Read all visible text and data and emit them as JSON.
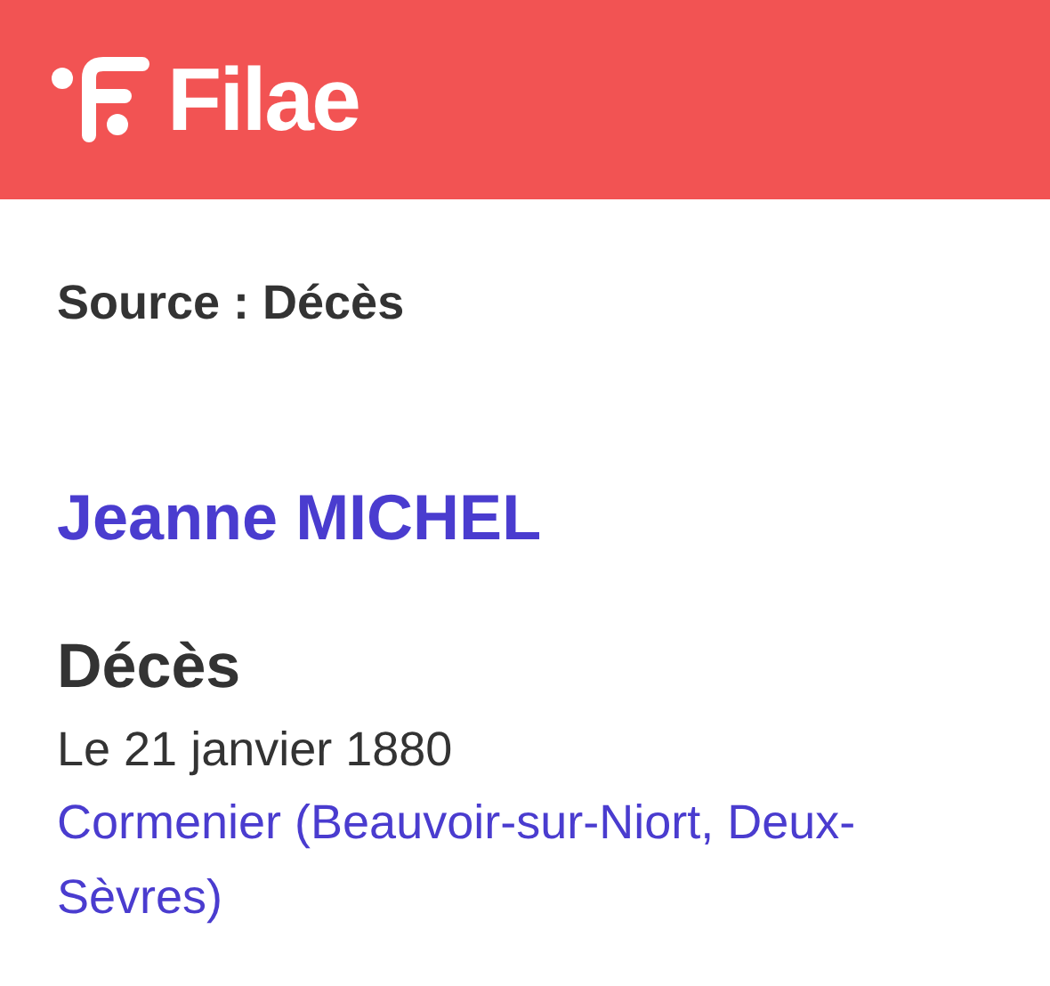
{
  "header": {
    "logo_text": "Filae"
  },
  "source": "Source : Décès",
  "person": {
    "name": "Jeanne MICHEL"
  },
  "event": {
    "title": "Décès",
    "date": "Le 21 janvier 1880",
    "place": "Cormenier (Beauvoir-sur-Niort, Deux-Sèvres)"
  }
}
